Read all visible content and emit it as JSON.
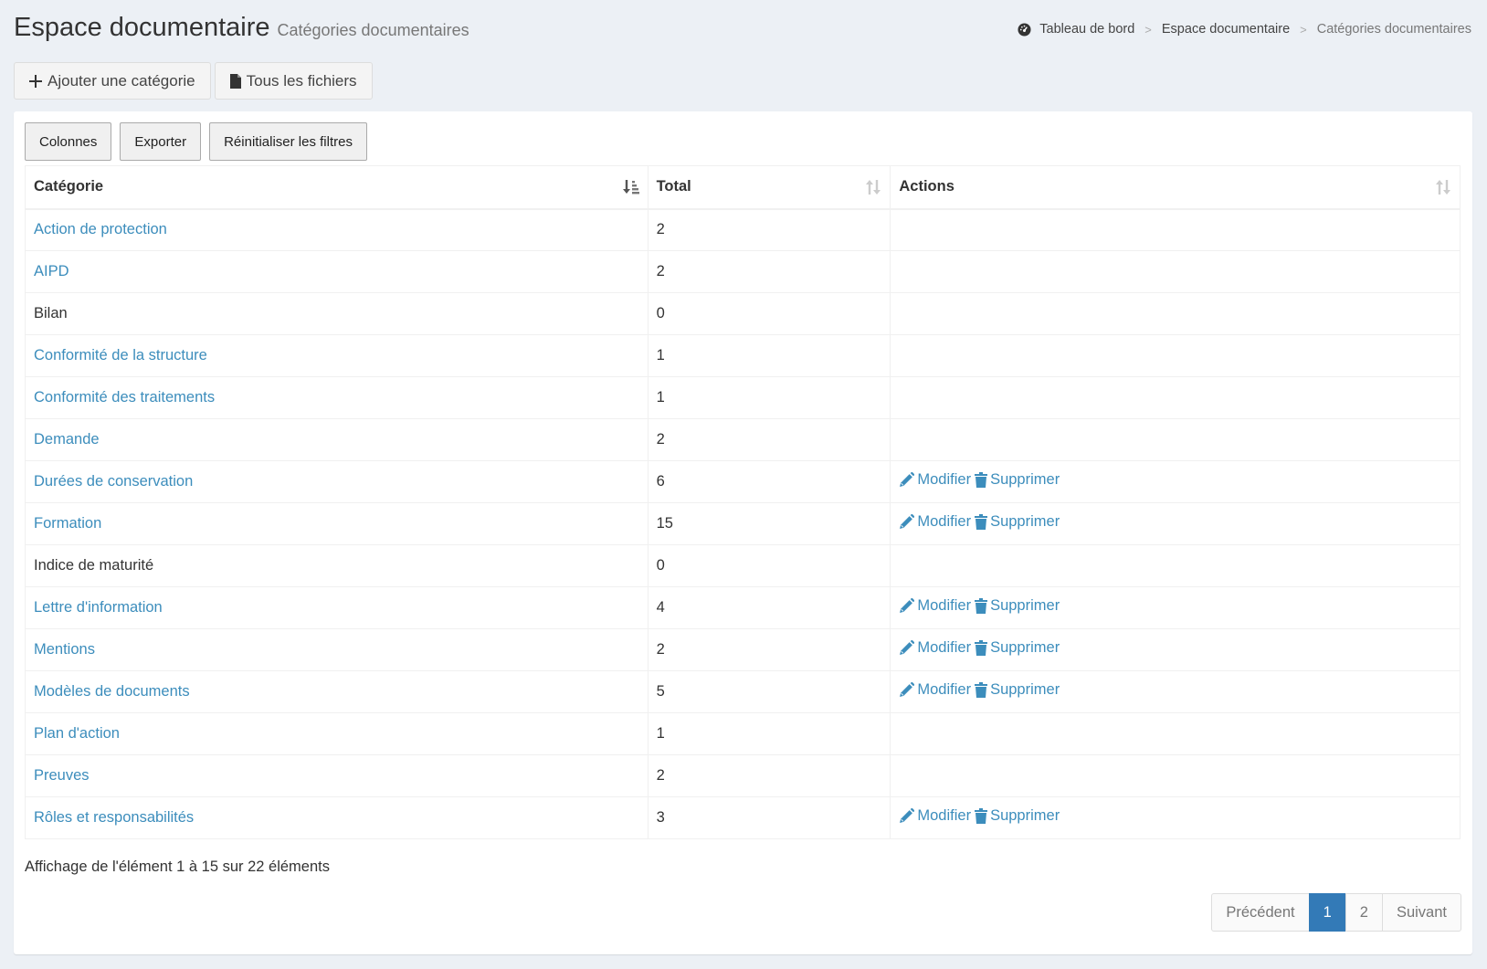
{
  "header": {
    "title": "Espace documentaire",
    "subtitle": "Catégories documentaires"
  },
  "breadcrumb": {
    "home": "Tableau de bord",
    "section": "Espace documentaire",
    "current": "Catégories documentaires",
    "separator": ">"
  },
  "top_actions": {
    "add_label": "Ajouter une catégorie",
    "files_label": "Tous les fichiers"
  },
  "table_tools": {
    "columns_label": "Colonnes",
    "export_label": "Exporter",
    "reset_label": "Réinitialiser les filtres"
  },
  "table": {
    "headers": [
      "Catégorie",
      "Total",
      "Actions"
    ],
    "edit_label": "Modifier",
    "delete_label": "Supprimer",
    "rows": [
      {
        "name": "Action de protection",
        "total": "2",
        "link": true,
        "actions": false
      },
      {
        "name": "AIPD",
        "total": "2",
        "link": true,
        "actions": false
      },
      {
        "name": "Bilan",
        "total": "0",
        "link": false,
        "actions": false
      },
      {
        "name": "Conformité de la structure",
        "total": "1",
        "link": true,
        "actions": false
      },
      {
        "name": "Conformité des traitements",
        "total": "1",
        "link": true,
        "actions": false
      },
      {
        "name": "Demande",
        "total": "2",
        "link": true,
        "actions": false
      },
      {
        "name": "Durées de conservation",
        "total": "6",
        "link": true,
        "actions": true
      },
      {
        "name": "Formation",
        "total": "15",
        "link": true,
        "actions": true
      },
      {
        "name": "Indice de maturité",
        "total": "0",
        "link": false,
        "actions": false
      },
      {
        "name": "Lettre d'information",
        "total": "4",
        "link": true,
        "actions": true
      },
      {
        "name": "Mentions",
        "total": "2",
        "link": true,
        "actions": true
      },
      {
        "name": "Modèles de documents",
        "total": "5",
        "link": true,
        "actions": true
      },
      {
        "name": "Plan d'action",
        "total": "1",
        "link": true,
        "actions": false
      },
      {
        "name": "Preuves",
        "total": "2",
        "link": true,
        "actions": false
      },
      {
        "name": "Rôles et responsabilités",
        "total": "3",
        "link": true,
        "actions": true
      }
    ]
  },
  "info": "Affichage de l'élément 1 à 15 sur 22 éléments",
  "pagination": {
    "previous": "Précédent",
    "pages": [
      "1",
      "2"
    ],
    "active_page": "1",
    "next": "Suivant"
  },
  "colors": {
    "link": "#3c8dbc",
    "active_page": "#337ab7",
    "background": "#ecf0f5"
  }
}
